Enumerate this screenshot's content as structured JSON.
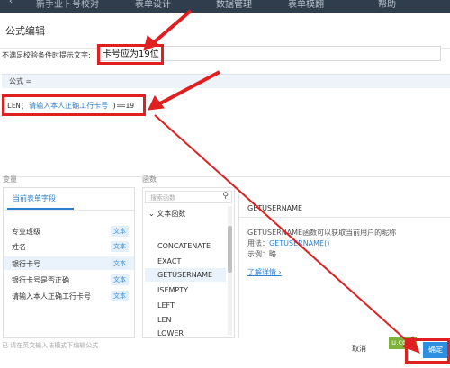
{
  "toolbar": {
    "items": [
      "新手业卜号校对",
      "表单设计",
      "数据管理",
      "表单模翻",
      "帮助"
    ]
  },
  "dialog": {
    "title": "公式编辑",
    "hint_label": "不满足校验条件时提示文字:",
    "hint_value": "卡号应为19位"
  },
  "formula": {
    "header": "公式 =",
    "code_prefix": "LEN(",
    "code_field": "请输入本人正确工行卡号",
    "code_suffix": ")==19"
  },
  "variables": {
    "section_label": "变量",
    "tab_label": "当前表单字段",
    "items": [
      {
        "name": "专业班级",
        "type": "文本",
        "selected": false
      },
      {
        "name": "姓名",
        "type": "文本",
        "selected": false
      },
      {
        "name": "银行卡号",
        "type": "文本",
        "selected": true
      },
      {
        "name": "银行卡号是否正确",
        "type": "文本",
        "selected": false
      },
      {
        "name": "请输入本人正确工行卡号",
        "type": "文本",
        "selected": false
      }
    ]
  },
  "functions": {
    "section_label": "函数",
    "search_placeholder": "搜索函数",
    "category": "文本函数",
    "items": [
      "CONCATENATE",
      "EXACT",
      "GETUSERNAME",
      "ISEMPTY",
      "LEFT",
      "LEN",
      "LOWER"
    ],
    "selected": "GETUSERNAME"
  },
  "description": {
    "title": "GETUSERNAME",
    "line1": "GETUSERNAME函数可以获取当前用户的昵称",
    "usage_prefix": "用法：",
    "usage_value": "GETUSERNAME()",
    "example": "示例：略",
    "link": "了解详情 ›"
  },
  "footer": {
    "hint": "已 请在英文输入法模式下编辑公式",
    "cancel_label": "取消",
    "ok_label": "确定",
    "watermark": "u.com"
  },
  "colors": {
    "accent": "#2d7fd0",
    "annotation": "#e02020",
    "ok_button": "#2d8fe0"
  }
}
